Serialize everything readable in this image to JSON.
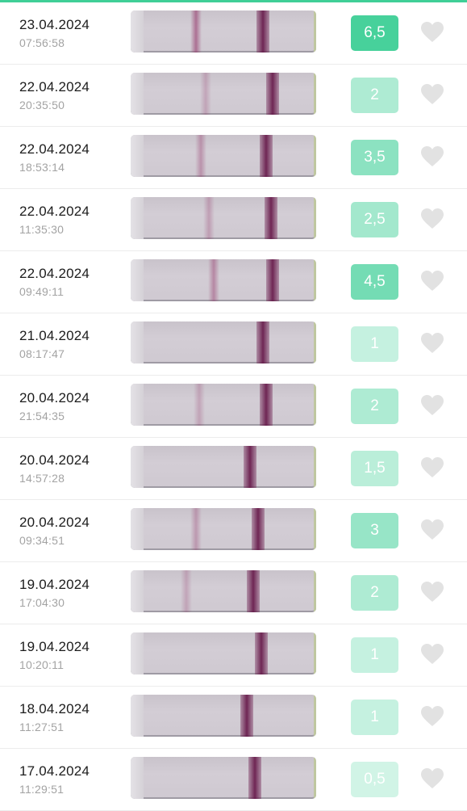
{
  "accent_color": "#3fcf97",
  "heart_icon": "heart-icon",
  "entries": [
    {
      "date": "23.04.2024",
      "time": "07:56:58",
      "score": "6,5",
      "level": 6.5
    },
    {
      "date": "22.04.2024",
      "time": "20:35:50",
      "score": "2",
      "level": 2
    },
    {
      "date": "22.04.2024",
      "time": "18:53:14",
      "score": "3,5",
      "level": 3.5
    },
    {
      "date": "22.04.2024",
      "time": "11:35:30",
      "score": "2,5",
      "level": 2.5
    },
    {
      "date": "22.04.2024",
      "time": "09:49:11",
      "score": "4,5",
      "level": 4.5
    },
    {
      "date": "21.04.2024",
      "time": "08:17:47",
      "score": "1",
      "level": 1
    },
    {
      "date": "20.04.2024",
      "time": "21:54:35",
      "score": "2",
      "level": 2
    },
    {
      "date": "20.04.2024",
      "time": "14:57:28",
      "score": "1,5",
      "level": 1.5
    },
    {
      "date": "20.04.2024",
      "time": "09:34:51",
      "score": "3",
      "level": 3
    },
    {
      "date": "19.04.2024",
      "time": "17:04:30",
      "score": "2",
      "level": 2
    },
    {
      "date": "19.04.2024",
      "time": "10:20:11",
      "score": "1",
      "level": 1
    },
    {
      "date": "18.04.2024",
      "time": "11:27:51",
      "score": "1",
      "level": 1
    },
    {
      "date": "17.04.2024",
      "time": "11:29:51",
      "score": "0,5",
      "level": 0.5
    }
  ]
}
